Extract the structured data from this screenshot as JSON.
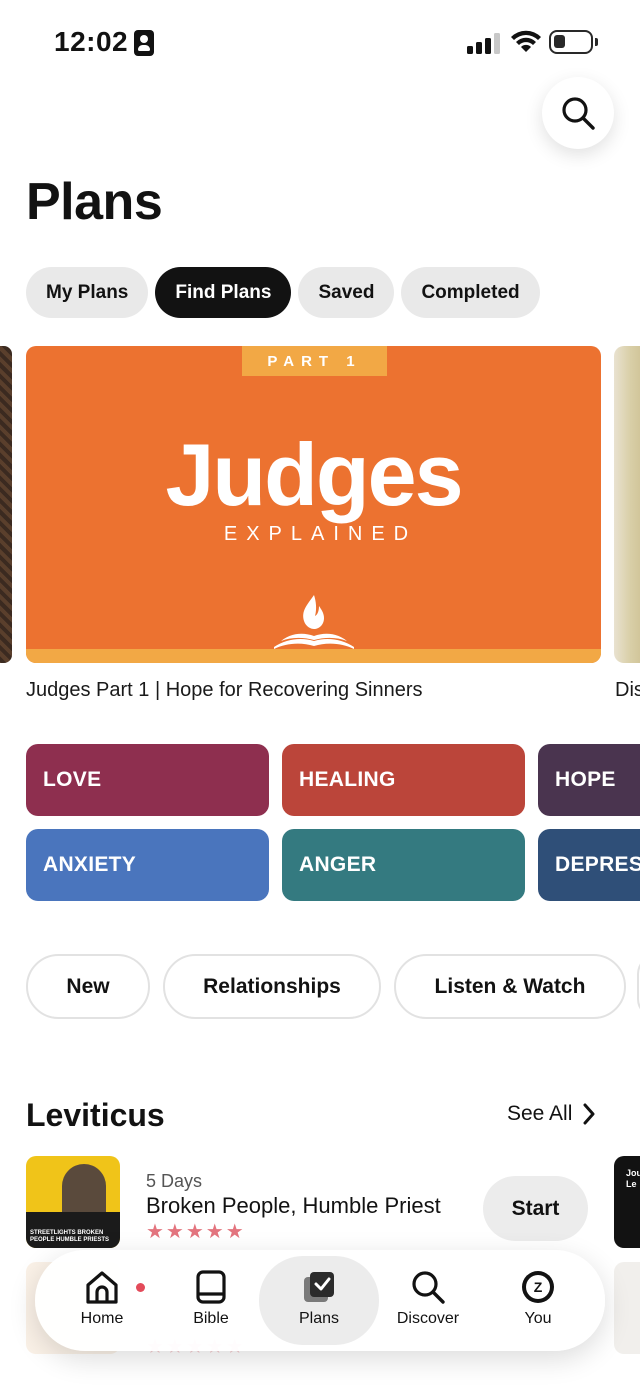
{
  "status_bar": {
    "time": "12:02"
  },
  "page": {
    "title": "Plans"
  },
  "tabs": [
    {
      "label": "My Plans",
      "active": false
    },
    {
      "label": "Find Plans",
      "active": true
    },
    {
      "label": "Saved",
      "active": false
    },
    {
      "label": "Completed",
      "active": false
    }
  ],
  "featured": {
    "banner_tag": "PART 1",
    "banner_title": "Judges",
    "banner_subtitle": "EXPLAINED",
    "caption": "Judges Part 1 | Hope for Recovering Sinners",
    "next_caption": "Dis"
  },
  "categories": [
    {
      "label": "LOVE",
      "color": "#8e2f4f"
    },
    {
      "label": "HEALING",
      "color": "#bb453a"
    },
    {
      "label": "HOPE",
      "color": "#4a344f"
    },
    {
      "label": "ANXIETY",
      "color": "#4a75bd"
    },
    {
      "label": "ANGER",
      "color": "#347a80"
    },
    {
      "label": "DEPRESSION",
      "color": "#2f4f78"
    }
  ],
  "filters": [
    {
      "label": "New"
    },
    {
      "label": "Relationships"
    },
    {
      "label": "Listen & Watch"
    }
  ],
  "section": {
    "title": "Leviticus",
    "see_all": "See All",
    "plan": {
      "days": "5 Days",
      "title": "Broken People, Humble Priest",
      "rating": 5,
      "stars": "★★★★★",
      "action": "Start",
      "thumb_text": "STREETLIGHTS BROKEN PEOPLE HUMBLE PRIESTS"
    },
    "next_thumb_text": "Jou Le"
  },
  "nav": {
    "items": [
      {
        "label": "Home",
        "icon": "home-icon",
        "active": false
      },
      {
        "label": "Bible",
        "icon": "bible-icon",
        "active": false
      },
      {
        "label": "Plans",
        "icon": "plans-icon",
        "active": true
      },
      {
        "label": "Discover",
        "icon": "discover-icon",
        "active": false
      },
      {
        "label": "You",
        "icon": "profile-avatar-icon",
        "active": false
      }
    ],
    "avatar_letter": "Z"
  },
  "colors": {
    "accent_dark": "#121212",
    "hero_orange": "#ec7230",
    "hero_gold": "#f2a845",
    "star": "#e3747e",
    "notification_dot": "#e34b5a"
  }
}
